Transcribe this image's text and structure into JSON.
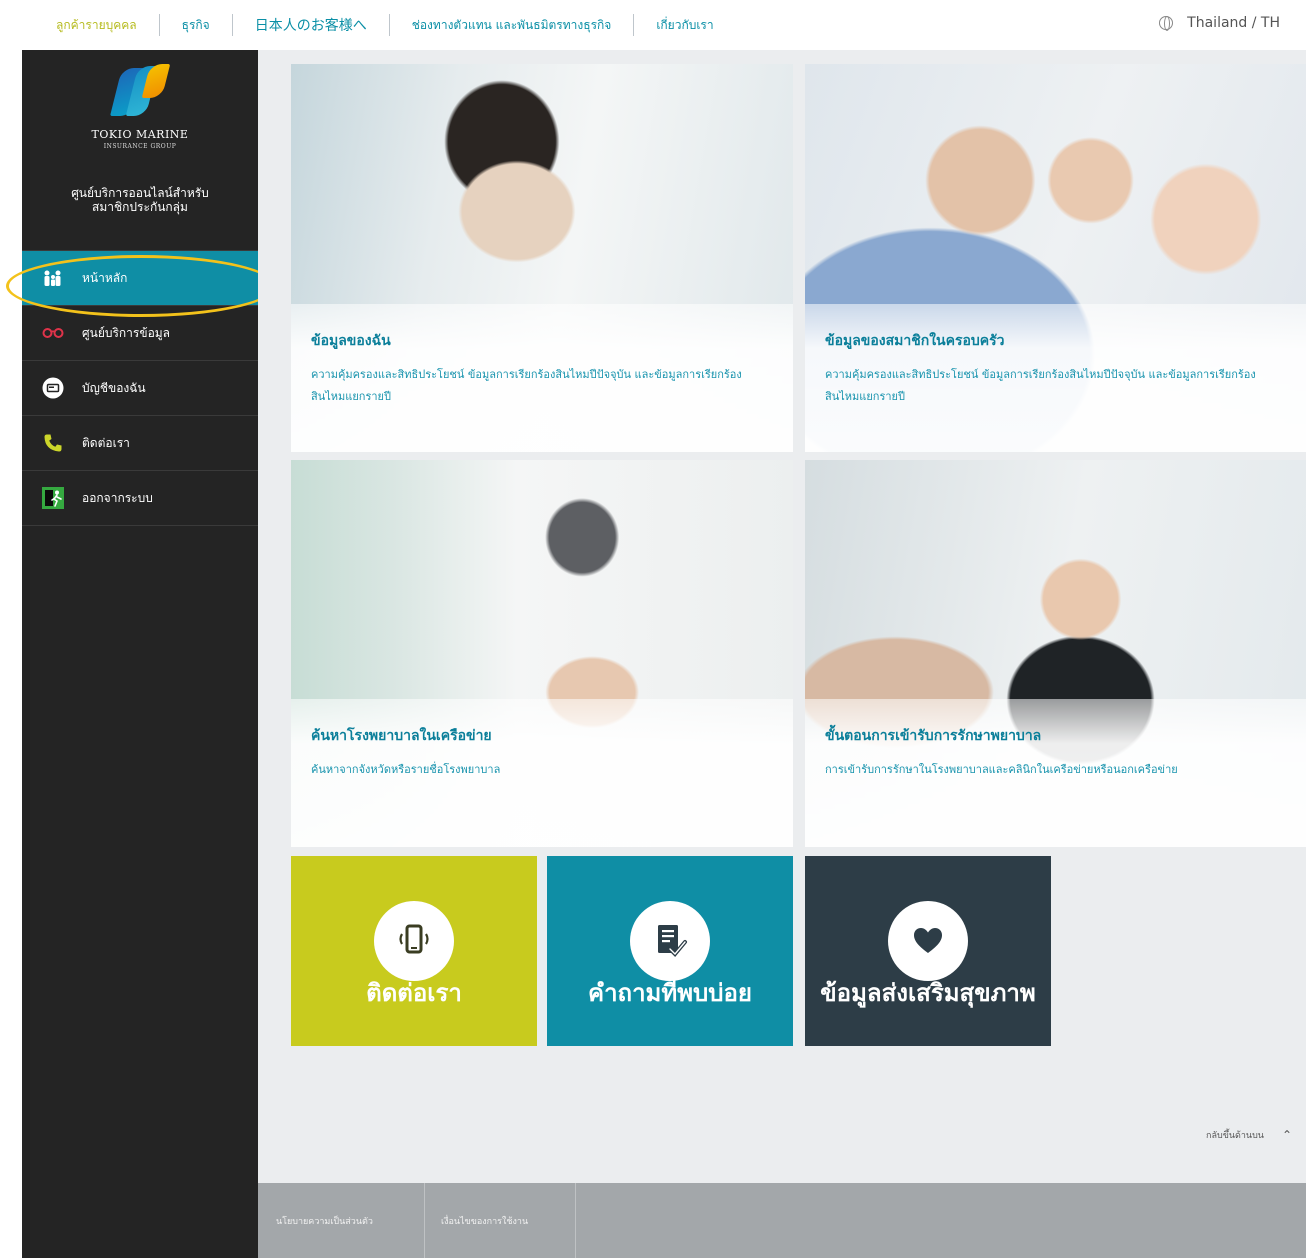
{
  "topnav": {
    "items": [
      {
        "label": "ลูกค้ารายบุคคล",
        "state": "active"
      },
      {
        "label": "ธุรกิจ",
        "state": "link"
      },
      {
        "label": "日本人のお客様へ",
        "state": "jp"
      },
      {
        "label": "ช่องทางตัวแทน และพันธมิตรทางธุรกิจ",
        "state": "link"
      },
      {
        "label": "เกี่ยวกับเรา",
        "state": "link"
      }
    ],
    "region": "Thailand / TH"
  },
  "sidebar": {
    "logo_name": "TOKIO MARINE",
    "logo_sub": "INSURANCE GROUP",
    "service_title_line1": "ศูนย์บริการออนไลน์สำหรับ",
    "service_title_line2": "สมาชิกประกันกลุ่ม",
    "items": [
      {
        "label": "หน้าหลัก",
        "icon": "family-icon",
        "active": true
      },
      {
        "label": "ศูนย์บริการข้อมูล",
        "icon": "glasses-icon",
        "active": false
      },
      {
        "label": "บัญชีของฉัน",
        "icon": "card-icon",
        "active": false
      },
      {
        "label": "ติดต่อเรา",
        "icon": "phone-icon",
        "active": false
      },
      {
        "label": "ออกจากระบบ",
        "icon": "exit-icon",
        "active": false
      }
    ]
  },
  "tiles": [
    {
      "title": "ข้อมูลของฉัน",
      "desc": "ความคุ้มครองและสิทธิประโยชน์ ข้อมูลการเรียกร้องสินไหมปีปัจจุบัน และข้อมูลการเรียกร้องสินไหมแยกรายปี"
    },
    {
      "title": "ข้อมูลของสมาชิกในครอบครัว",
      "desc": "ความคุ้มครองและสิทธิประโยชน์ ข้อมูลการเรียกร้องสินไหมปีปัจจุบัน และข้อมูลการเรียกร้องสินไหมแยกรายปี"
    },
    {
      "title": "ค้นหาโรงพยาบาลในเครือข่าย",
      "desc": "ค้นหาจากจังหวัดหรือรายชื่อโรงพยาบาล"
    },
    {
      "title": "ขั้นตอนการเข้ารับการรักษาพยาบาล",
      "desc": "การเข้ารับการรักษาในโรงพยาบาลและคลินิกในเครือข่ายหรือนอกเครือข่าย"
    }
  ],
  "quick_tiles": [
    {
      "label": "ติดต่อเรา",
      "icon": "mobile-phone-icon",
      "color": "#c8cb1e"
    },
    {
      "label": "คำถามที่พบบ่อย",
      "icon": "checklist-icon",
      "color": "#0f8ea5"
    },
    {
      "label": "ข้อมูลส่งเสริมสุขภาพ",
      "icon": "heart-icon",
      "color": "#2d3d47"
    }
  ],
  "back_to_top": "กลับขึ้นด้านบน",
  "footer": {
    "privacy": "นโยบายความเป็นส่วนตัว",
    "terms": "เงื่อนไขของการใช้งาน"
  },
  "colors": {
    "accent": "#0f8ea5",
    "sidebar": "#242424",
    "highlight": "#f3c21b"
  }
}
